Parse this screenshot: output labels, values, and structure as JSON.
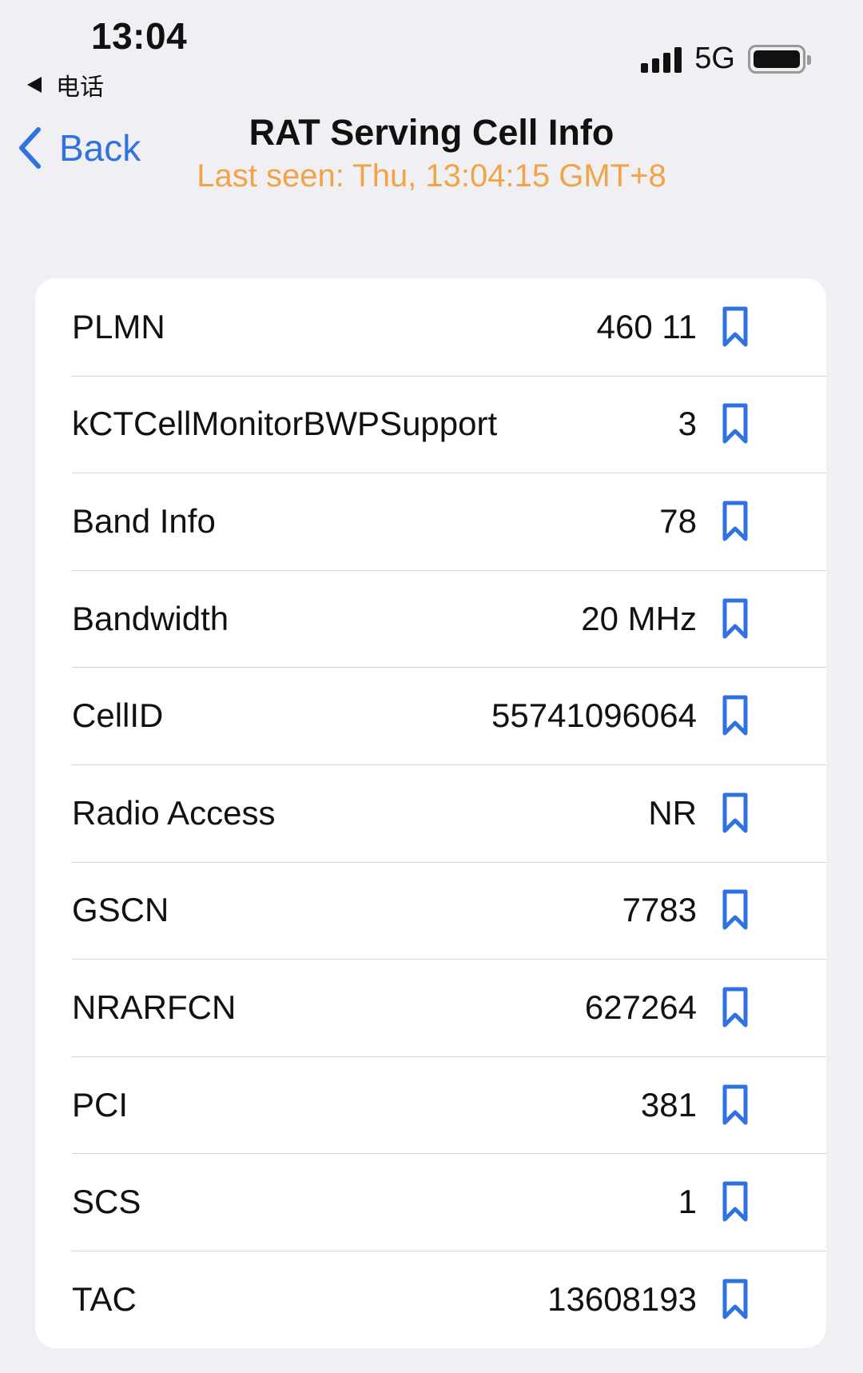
{
  "status_bar": {
    "time": "13:04",
    "back_app": "电话",
    "network": "5G",
    "signal_bars": 4
  },
  "nav": {
    "back_label": "Back",
    "title": "RAT Serving Cell Info",
    "subtitle": "Last seen: Thu, 13:04:15 GMT+8"
  },
  "colors": {
    "accent": "#2f72e0",
    "subtitle": "#f0a445",
    "background": "#f0f0f4",
    "card": "#ffffff"
  },
  "rows": [
    {
      "label": "PLMN",
      "value": "460 11",
      "icon": "bookmark-icon"
    },
    {
      "label": "kCTCellMonitorBWPSupport",
      "value": "3",
      "icon": "bookmark-icon"
    },
    {
      "label": "Band Info",
      "value": "78",
      "icon": "bookmark-icon"
    },
    {
      "label": "Bandwidth",
      "value": "20 MHz",
      "icon": "bookmark-icon"
    },
    {
      "label": "CellID",
      "value": "55741096064",
      "icon": "bookmark-icon"
    },
    {
      "label": "Radio Access",
      "value": "NR",
      "icon": "bookmark-icon"
    },
    {
      "label": "GSCN",
      "value": "7783",
      "icon": "bookmark-icon"
    },
    {
      "label": "NRARFCN",
      "value": "627264",
      "icon": "bookmark-icon"
    },
    {
      "label": "PCI",
      "value": "381",
      "icon": "bookmark-icon"
    },
    {
      "label": "SCS",
      "value": "1",
      "icon": "bookmark-icon"
    },
    {
      "label": "TAC",
      "value": "13608193",
      "icon": "bookmark-icon"
    }
  ]
}
